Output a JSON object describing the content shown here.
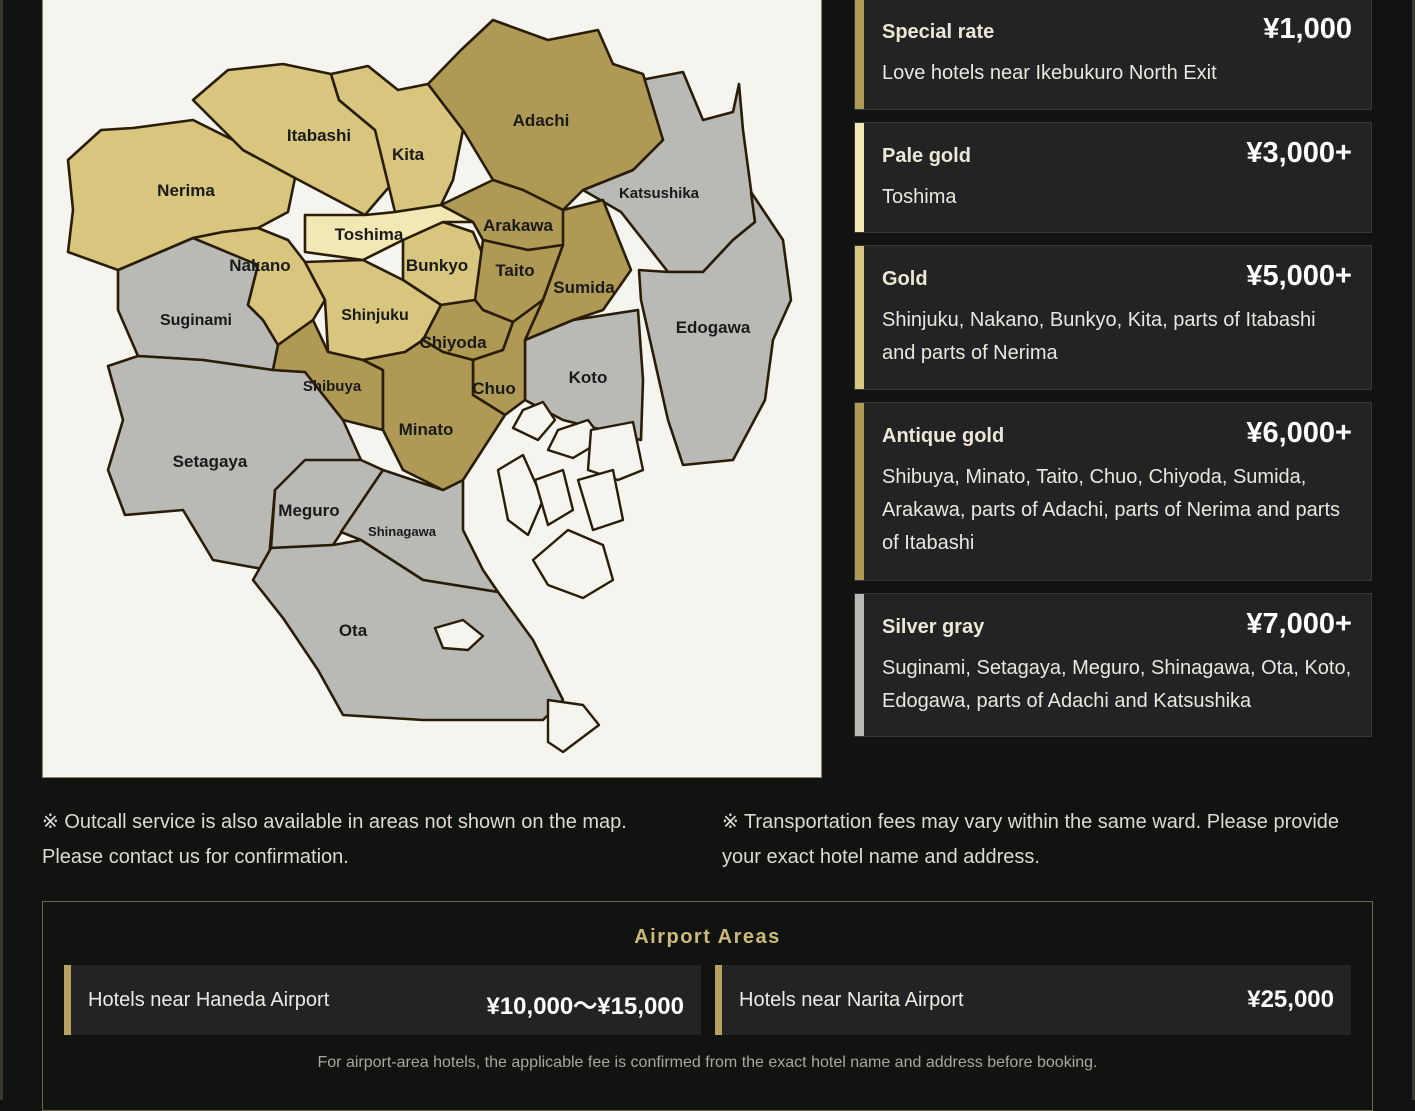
{
  "colors": {
    "special": "#b09a55",
    "pale_gold": "#f3e7b3",
    "gold": "#d8c57e",
    "antique_gold": "#af9a55",
    "silver_gray": "#b9b9b5"
  },
  "map": {
    "wards": {
      "adachi": "Adachi",
      "kita": "Kita",
      "itabashi": "Itabashi",
      "nerima": "Nerima",
      "katsushika": "Katsushika",
      "arakawa": "Arakawa",
      "toshima": "Toshima",
      "nakano": "Nakano",
      "bunkyo": "Bunkyo",
      "taito": "Taito",
      "sumida": "Sumida",
      "edogawa": "Edogawa",
      "suginami": "Suginami",
      "shinjuku": "Shinjuku",
      "chiyoda": "Chiyoda",
      "koto": "Koto",
      "shibuya": "Shibuya",
      "chuo": "Chuo",
      "minato": "Minato",
      "setagaya": "Setagaya",
      "meguro": "Meguro",
      "shinagawa": "Shinagawa",
      "ota": "Ota"
    }
  },
  "rates": [
    {
      "name": "Special rate",
      "price": "¥1,000",
      "areas": "Love hotels near Ikebukuro North Exit"
    },
    {
      "name": "Pale gold",
      "price": "¥3,000+",
      "areas": "Toshima"
    },
    {
      "name": "Gold",
      "price": "¥5,000+",
      "areas": "Shinjuku, Nakano, Bunkyo, Kita, parts of Itabashi and parts of Nerima"
    },
    {
      "name": "Antique gold",
      "price": "¥6,000+",
      "areas": "Shibuya, Minato, Taito, Chuo, Chiyoda, Sumida, Arakawa, parts of Adachi, parts of Nerima and parts of Itabashi"
    },
    {
      "name": "Silver gray",
      "price": "¥7,000+",
      "areas": "Suginami, Setagaya, Meguro, Shinagawa, Ota, Koto, Edogawa, parts of Adachi and Katsushika"
    }
  ],
  "notes": {
    "left": "※ Outcall service is also available in areas not shown on the map. Please contact us for confirmation.",
    "right": "※ Transportation fees may vary within the same ward. Please provide your exact hotel name and address."
  },
  "airport": {
    "title": "Airport Areas",
    "items": [
      {
        "name": "Hotels near Haneda Airport",
        "price": "¥10,000〜¥15,000"
      },
      {
        "name": "Hotels near Narita Airport",
        "price": "¥25,000"
      }
    ],
    "footnote": "For airport-area hotels, the applicable fee is confirmed from the exact hotel name and address before booking."
  }
}
